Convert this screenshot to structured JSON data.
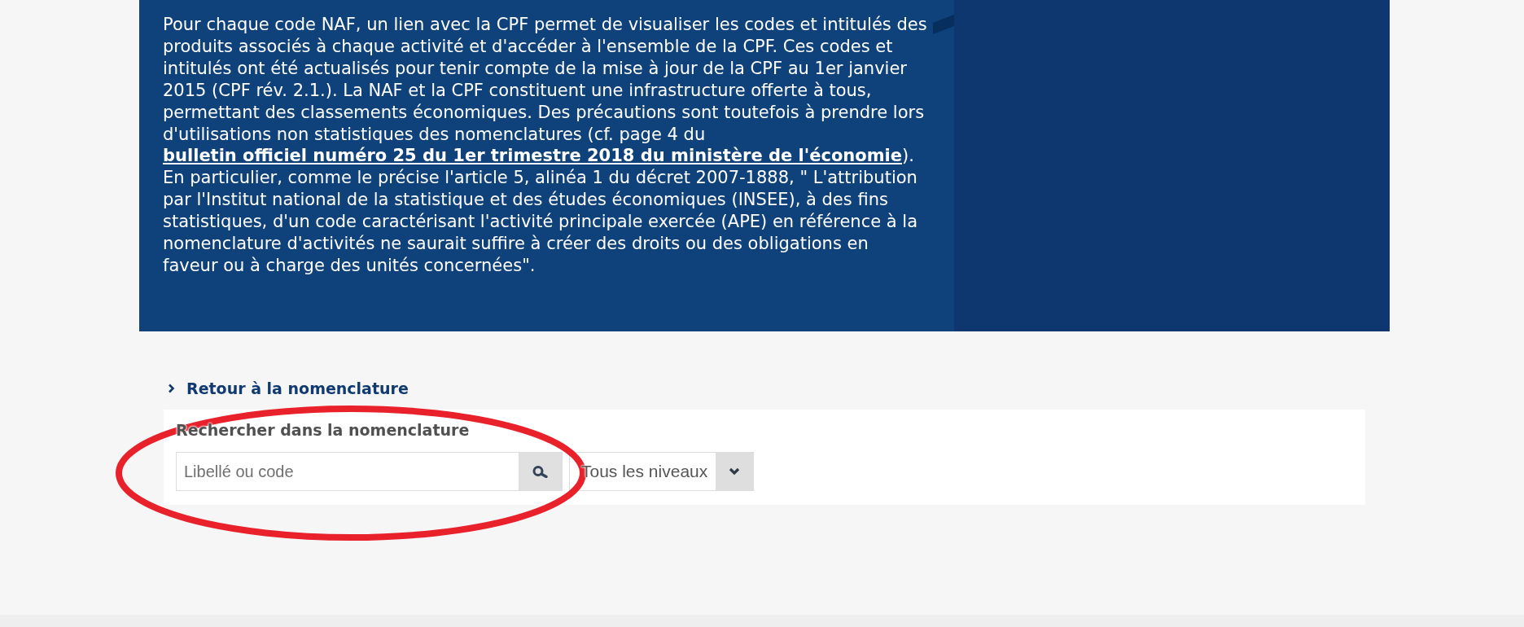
{
  "intro_panel": {
    "paragraph": [
      {
        "kind": "text",
        "text": "Pour chaque code NAF, un lien avec la CPF permet de visualiser les codes et intitulés des produits associés à chaque activité et d'accéder à l'ensemble de la CPF. Ces codes et intitulés ont été actualisés pour tenir compte de la mise à jour de la CPF au 1er janvier 2015 (CPF rév. 2.1.). La NAF et la CPF constituent une infrastructure offerte à tous, permettant des classements économiques. Des précautions sont toutefois à prendre lors d'utilisations non statistiques des nomenclatures (cf. page 4 du "
      },
      {
        "kind": "link",
        "text": "bulletin officiel numéro 25 du 1er trimestre 2018 du ministère de l'économie"
      },
      {
        "kind": "text",
        "text": "). En particulier, comme le précise l'article 5, alinéa 1 du décret 2007-1888, \" L'attribution par l'Institut national de la statistique et des études économiques (INSEE), à des fins statistiques, d'un code caractérisant l'activité principale exercée (APE) en référence à la nomenclature d'activités ne saurait suffire à créer des droits ou des obligations en faveur ou à charge des unités concernées\"."
      }
    ]
  },
  "back_link": {
    "label": "Retour à la nomenclature"
  },
  "search_panel": {
    "title": "Rechercher dans la nomenclature",
    "search": {
      "placeholder": "Libellé ou code"
    },
    "level_select": {
      "value": "Tous les niveaux"
    }
  },
  "annotation": {
    "kind": "ellipse"
  }
}
